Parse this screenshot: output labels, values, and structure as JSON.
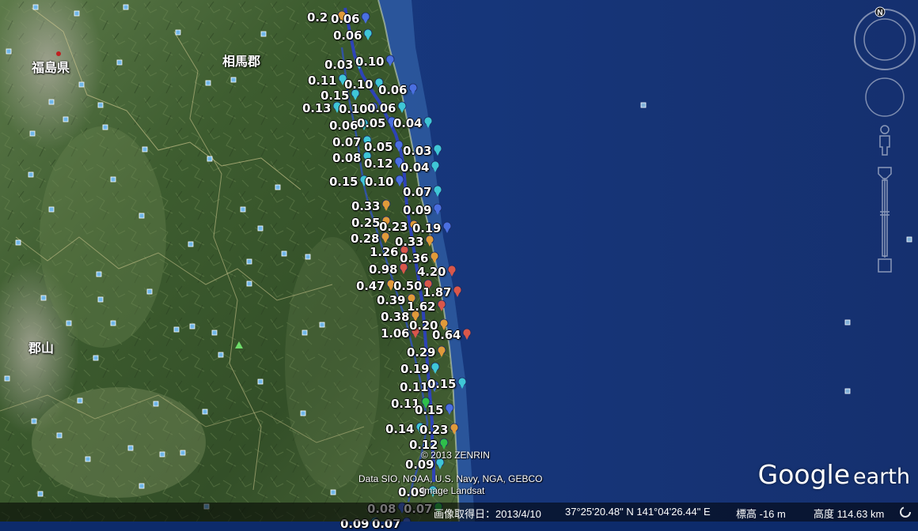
{
  "place_labels": [
    "福島県",
    "相馬郡",
    "郡山"
  ],
  "readings": [
    "0.2",
    "0.06",
    "0.06",
    "0.03",
    "0.10",
    "0.11",
    "0.10",
    "0.06",
    "0.15",
    "0.13",
    "0.10",
    "0.06",
    "0.06",
    "0.05",
    "0.04",
    "0.07",
    "0.05",
    "0.03",
    "0.08",
    "0.12",
    "0.04",
    "0.15",
    "0.10",
    "0.07",
    "0.33",
    "0.09",
    "0.25",
    "0.23",
    "0.19",
    "0.28",
    "0.33",
    "1.26",
    "0.36",
    "0.98",
    "4.20",
    "0.47",
    "0.50",
    "1.87",
    "0.39",
    "1.62",
    "0.38",
    "0.20",
    "1.06",
    "0.64",
    "0.29",
    "0.19",
    "0.11",
    "0.15",
    "0.11",
    "0.15",
    "0.14",
    "0.23",
    "0.12",
    "0.09",
    "0.09",
    "0.08",
    "0.07",
    "0.09",
    "0.07"
  ],
  "credits": {
    "zenrin": "© 2013 ZENRIN",
    "data": "Data SIO, NOAA, U.S. Navy, NGA, GEBCO",
    "image": "Image Landsat"
  },
  "logo": {
    "brand": "Google",
    "product": "earth"
  },
  "status": {
    "imagery_date": "画像取得日：2013/4/10",
    "coordinates": "37°25'20.48\" N  141°04'26.44\" E",
    "elevation": "標高   -16 m",
    "eye_altitude": "高度 114.63 km"
  },
  "colors": {
    "sea": "#17357a",
    "land": "#3b5a2c",
    "marker_low": "#3fc6d6",
    "marker_mid": "#4a6fe0",
    "marker_high": "#d9574a",
    "marker_green": "#2fbf4a"
  }
}
